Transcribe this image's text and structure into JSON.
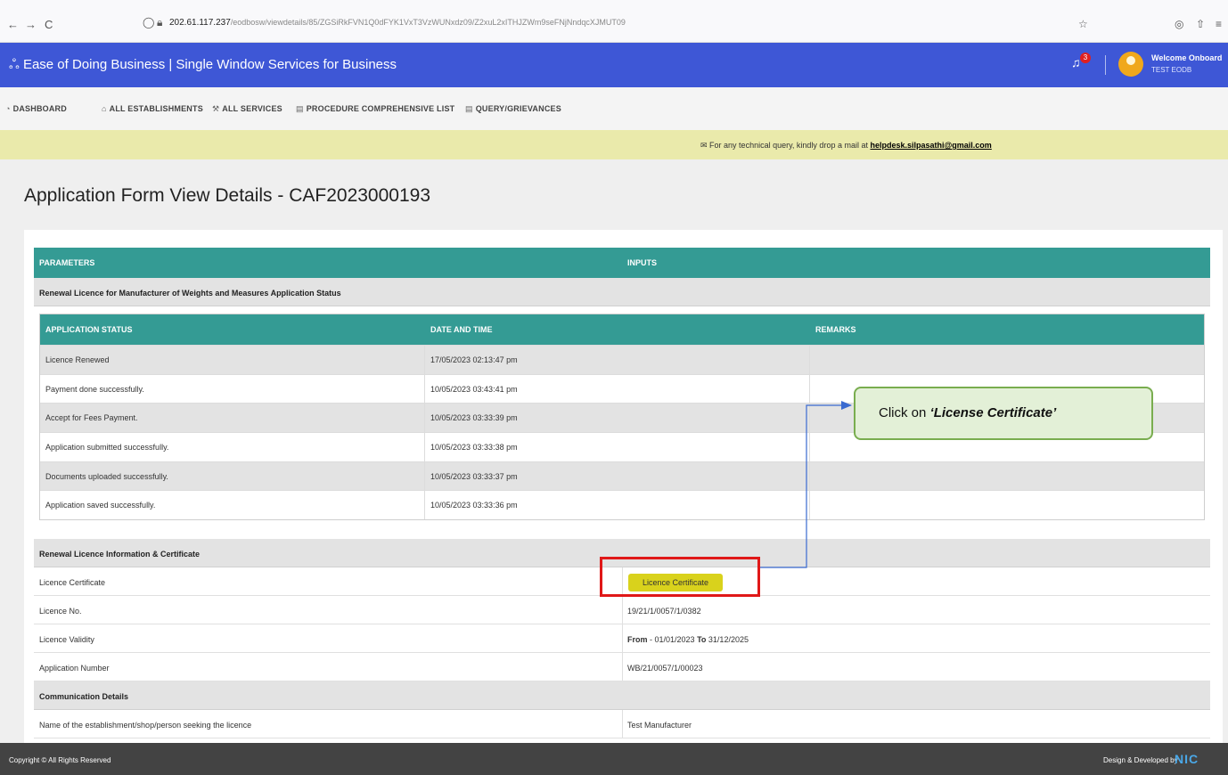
{
  "browser": {
    "back": "←",
    "forward": "→",
    "reload": "C",
    "url_host": "202.61.117.237",
    "url_path": "/eodbosw/viewdetails/85/ZGSiRkFVN1Q0dFYK1VxT3VzWUNxdz09/Z2xuL2xITHJZWm9seFNjNndqcXJMUT09"
  },
  "header": {
    "title": "Ease of Doing Business | Single Window Services for Business",
    "notification_count": "3",
    "welcome": "Welcome Onboard",
    "user": "TEST EODB"
  },
  "nav": {
    "items": [
      {
        "label": "DASHBOARD"
      },
      {
        "label": "ALL ESTABLISHMENTS"
      },
      {
        "label": "ALL SERVICES"
      },
      {
        "label": "PROCEDURE COMPREHENSIVE LIST"
      },
      {
        "label": "QUERY/GRIEVANCES"
      }
    ]
  },
  "notice": {
    "text": "For any technical query, kindly drop a mail at",
    "email": "helpdesk.silpasathi@gmail.com"
  },
  "page": {
    "title": "Application Form View Details - CAF2023000193"
  },
  "table": {
    "col_parameters": "PARAMETERS",
    "col_inputs": "INPUTS",
    "status_section": "Renewal Licence for Manufacturer of Weights and Measures Application Status",
    "status_cols": [
      "APPLICATION STATUS",
      "DATE AND TIME",
      "REMARKS"
    ],
    "status_rows": [
      {
        "status": "Licence Renewed",
        "datetime": "17/05/2023 02:13:47 pm",
        "remarks": ""
      },
      {
        "status": "Payment done successfully.",
        "datetime": "10/05/2023 03:43:41 pm",
        "remarks": ""
      },
      {
        "status": "Accept for Fees Payment.",
        "datetime": "10/05/2023 03:33:39 pm",
        "remarks": ""
      },
      {
        "status": "Application submitted successfully.",
        "datetime": "10/05/2023 03:33:38 pm",
        "remarks": ""
      },
      {
        "status": "Documents uploaded successfully.",
        "datetime": "10/05/2023 03:33:37 pm",
        "remarks": ""
      },
      {
        "status": "Application saved successfully.",
        "datetime": "10/05/2023 03:33:36 pm",
        "remarks": ""
      }
    ],
    "licence_section": "Renewal Licence Information & Certificate",
    "licence_certificate_label": "Licence Certificate",
    "licence_certificate_button": "Licence Certificate",
    "licence_no_label": "Licence No.",
    "licence_no": "19/21/1/0057/1/0382",
    "validity_label": "Licence Validity",
    "validity_from_word": "From",
    "validity_from": "- 01/01/2023",
    "validity_to_word": "To",
    "validity_to": "31/12/2025",
    "application_number_label": "Application Number",
    "application_number": "WB/21/0057/1/00023",
    "communication_section": "Communication Details",
    "establishment_label": "Name of the establishment/shop/person seeking the licence",
    "establishment_value": "Test Manufacturer"
  },
  "callout": {
    "prefix": "Click on",
    "target": "‘License Certificate’"
  },
  "footer": {
    "copyright": "Copyright © All Rights Reserved",
    "developed": "Design & Developed by",
    "nic": "NIC"
  },
  "colors": {
    "header_blue": "#3e57d6",
    "teal": "#349b94",
    "notice_yellow": "#eaeaab",
    "button_yellow": "#d9d21c",
    "highlight_red": "#e01818"
  }
}
